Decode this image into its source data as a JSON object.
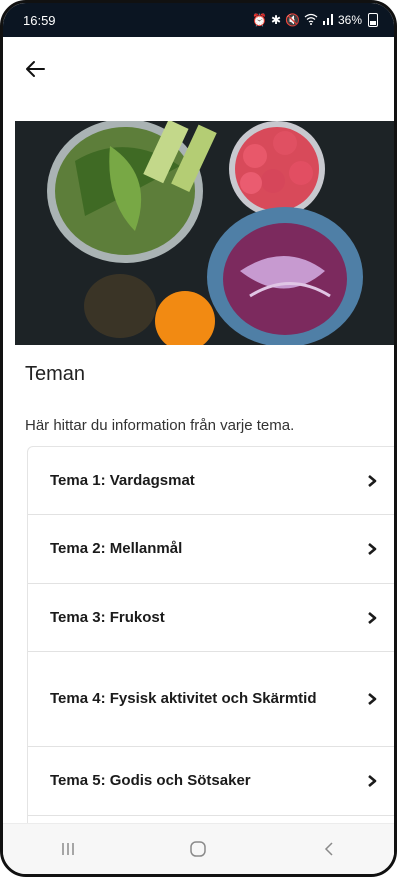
{
  "status": {
    "time": "16:59",
    "icons": [
      "alarm-icon",
      "bluetooth-icon",
      "mute-icon",
      "wifi-icon",
      "signal-icon"
    ],
    "battery": "36%"
  },
  "header": {
    "back_icon": "arrow-left-icon"
  },
  "hero": {
    "image": "food-bowls-photo"
  },
  "section": {
    "title": "Teman",
    "description": "Här hittar du information från varje tema."
  },
  "topics": [
    {
      "label": "Tema 1: Vardagsmat"
    },
    {
      "label": "Tema 2: Mellanmål"
    },
    {
      "label": "Tema 3: Frukost"
    },
    {
      "label": "Tema 4: Fysisk aktivitet och Skärmtid"
    },
    {
      "label": "Tema 5: Godis och Sötsaker"
    },
    {
      "label": ""
    }
  ],
  "navbar": {
    "icons": [
      "recent-apps-icon",
      "home-icon",
      "back-nav-icon"
    ]
  },
  "colors": {
    "statusbar": "#0b1522",
    "text": "#1b1b1b",
    "divider": "#e2e2e2"
  }
}
